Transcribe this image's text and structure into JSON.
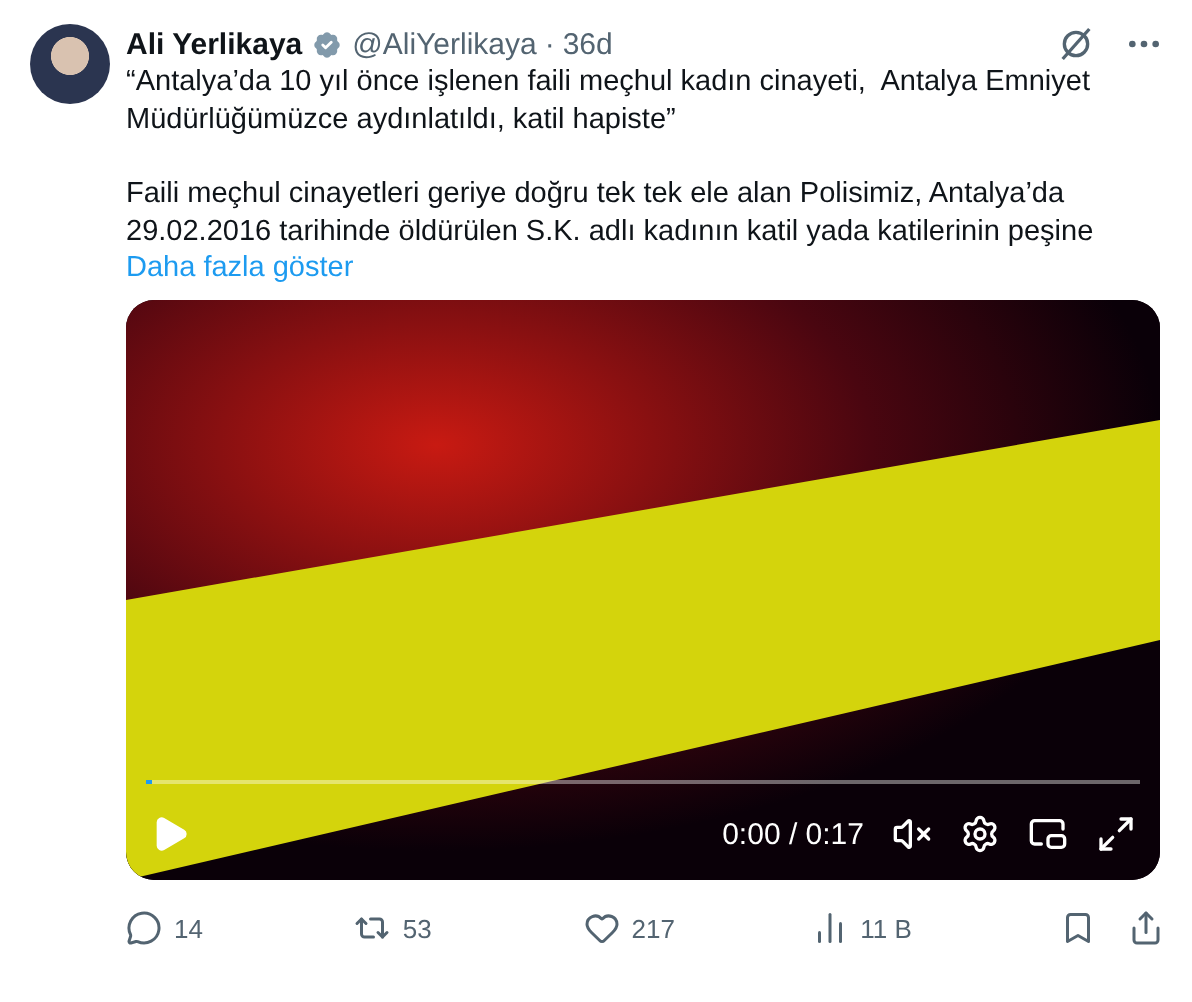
{
  "tweet": {
    "author": {
      "name": "Ali Yerlikaya",
      "verified": true,
      "handle": "@AliYerlikaya",
      "separator": "·",
      "time": "36d"
    },
    "paragraphs": [
      "“Antalya’da 10 yıl önce işlenen faili meçhul kadın cinayeti,  Antalya Emniyet Müdürlüğümüzce aydınlatıldı, katil hapiste”",
      "Faili meçhul cinayetleri geriye doğru tek tek ele alan Polisimiz, Antalya’da 29.02.2016 tarihinde öldürülen S.K. adlı kadının katil yada katilerinin peşine"
    ],
    "show_more": "Daha fazla göster",
    "video": {
      "time": "0:00 / 0:17",
      "muted": true,
      "level": 0
    },
    "actions": [
      {
        "kind": "reply",
        "count": "14"
      },
      {
        "kind": "repost",
        "count": "53"
      },
      {
        "kind": "like",
        "count": "217"
      },
      {
        "kind": "views",
        "count": "11 B"
      },
      {
        "kind": "bookmark"
      },
      {
        "kind": "share"
      }
    ]
  }
}
